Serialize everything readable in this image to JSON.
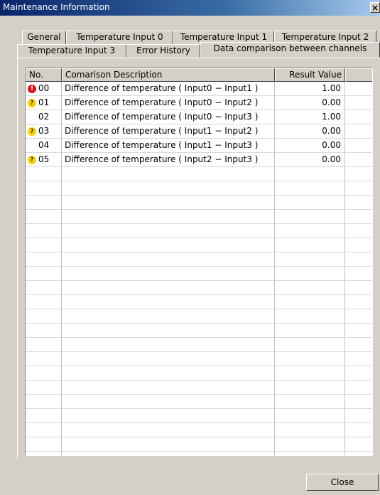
{
  "window": {
    "title": "Maintenance Information",
    "close_glyph": "×"
  },
  "tabs": {
    "row1": [
      "General",
      "Temperature Input 0",
      "Temperature Input 1",
      "Temperature Input 2"
    ],
    "row2": [
      "Temperature Input 3",
      "Error History",
      "Data comparison between channels"
    ],
    "active": "Data comparison between channels"
  },
  "table": {
    "columns": [
      "No.",
      "Comarison Description",
      "Result Value"
    ],
    "rows": [
      {
        "icon": "error-icon",
        "no": "00",
        "description": "Difference of temperature ( Input0 − Input1 )",
        "value": "1.00"
      },
      {
        "icon": "warning-icon",
        "no": "01",
        "description": "Difference of temperature ( Input0 − Input2 )",
        "value": "0.00"
      },
      {
        "icon": "",
        "no": "02",
        "description": "Difference of temperature ( Input0 − Input3 )",
        "value": "1.00"
      },
      {
        "icon": "warning-icon",
        "no": "03",
        "description": "Difference of temperature ( Input1 − Input2 )",
        "value": "0.00"
      },
      {
        "icon": "",
        "no": "04",
        "description": "Difference of temperature ( Input1 − Input3 )",
        "value": "0.00"
      },
      {
        "icon": "warning-icon",
        "no": "05",
        "description": "Difference of temperature ( Input2 − Input3 )",
        "value": "0.00"
      }
    ]
  },
  "footer": {
    "close_label": "Close"
  },
  "colors": {
    "error": "#d8121b",
    "warning": "#f6d10a",
    "titlebar": "#0a246a"
  }
}
